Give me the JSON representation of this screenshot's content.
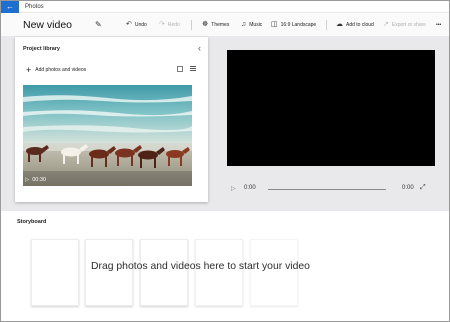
{
  "app": {
    "name": "Photos",
    "back_icon": "back-arrow-icon"
  },
  "project": {
    "title": "New video"
  },
  "toolbar": {
    "undo": "Undo",
    "redo": "Redo",
    "themes": "Themes",
    "music": "Music",
    "aspect": "16:9 Landscape",
    "add_to_cloud": "Add to cloud",
    "export": "Export or share",
    "more": "•••"
  },
  "library": {
    "title": "Project library",
    "add_label": "Add photos and videos",
    "clip_duration": "00:30"
  },
  "player": {
    "current_time": "0:00",
    "total_time": "0:00",
    "progress": 0
  },
  "storyboard": {
    "label": "Storyboard",
    "hint": "Drag photos and videos here to start your video"
  },
  "colors": {
    "accent": "#1e6fd0",
    "preview_bg": "#000000",
    "upper_bg": "#e9e9eb"
  }
}
